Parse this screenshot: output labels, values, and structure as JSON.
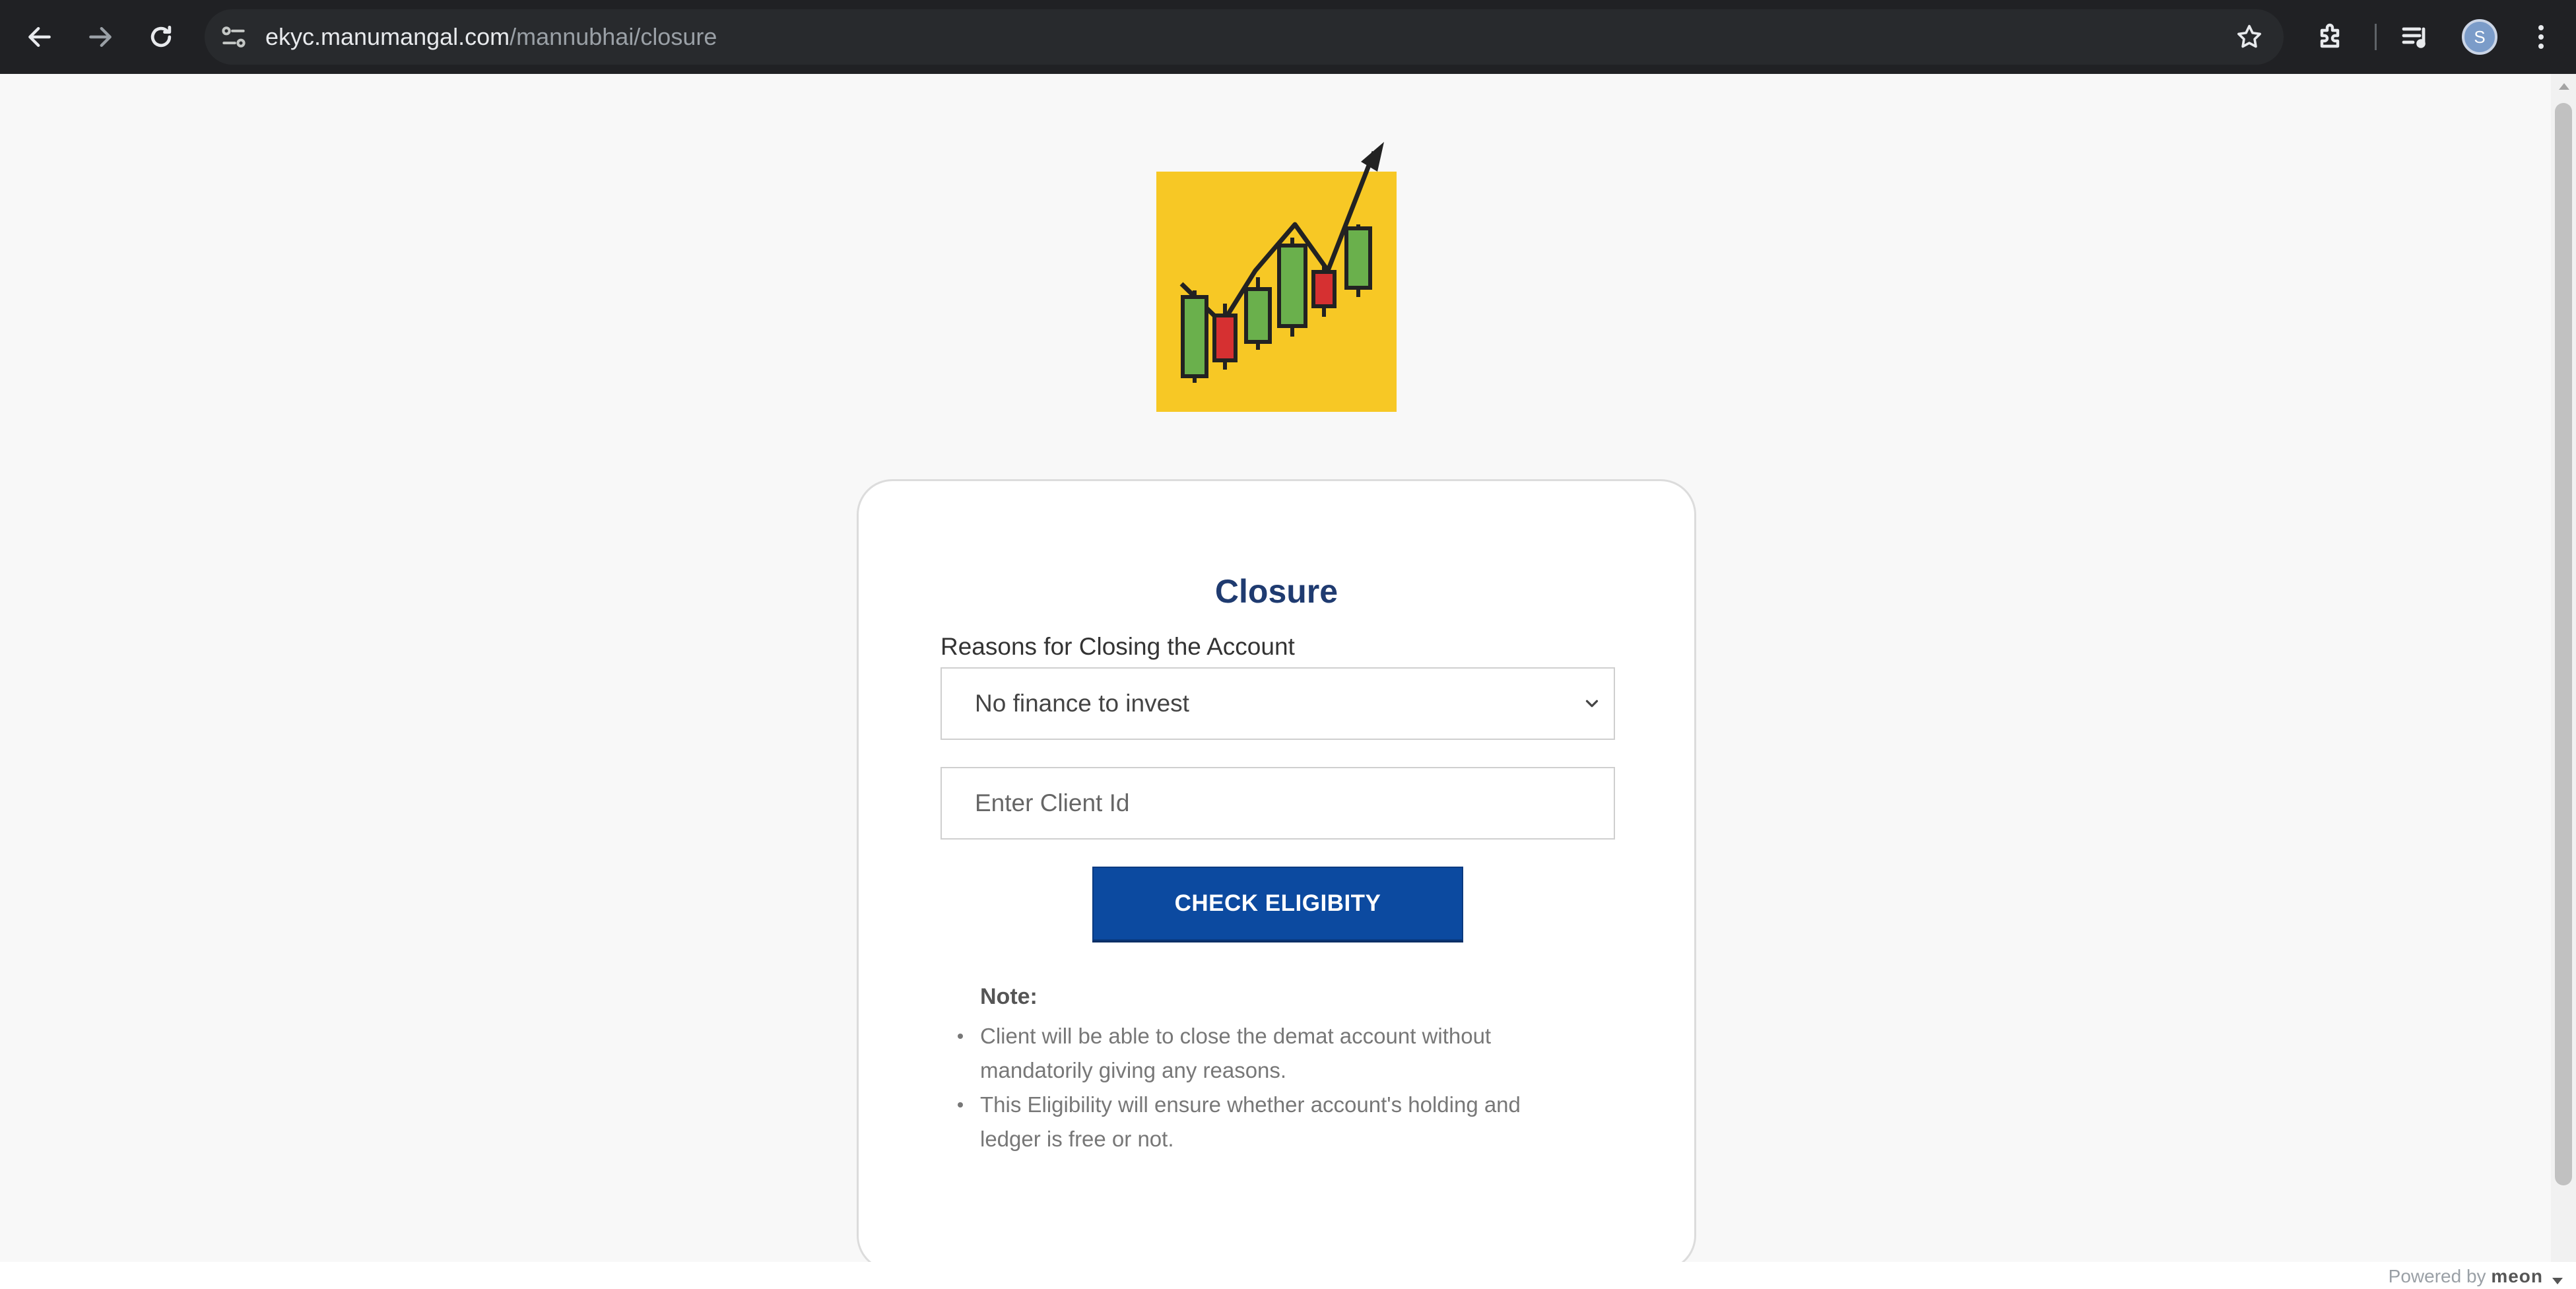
{
  "browser": {
    "url_host": "ekyc.manumangal.com",
    "url_path": "/mannubhai/closure",
    "profile_initial": "S"
  },
  "card": {
    "title": "Closure",
    "reason_label": "Reasons for Closing the Account",
    "reason_selected": "No finance to invest",
    "client_id_placeholder": "Enter Client Id",
    "check_button": "CHECK ELIGIBITY"
  },
  "note": {
    "title": "Note:",
    "items": [
      {
        "line1": "Client will be able to close the demat account without",
        "line2": "mandatorily giving any reasons."
      },
      {
        "line1": "This Eligibility will ensure whether account's holding and",
        "line2": "ledger is free or not."
      }
    ]
  },
  "footer": {
    "powered_prefix": "Powered by",
    "powered_brand": "meon"
  },
  "icons": {
    "back": "arrow-left-icon",
    "forward": "arrow-right-icon",
    "reload": "reload-icon",
    "site_info": "tune-icon",
    "bookmark": "star-icon",
    "extensions": "puzzle-icon",
    "media": "queue-music-icon",
    "menu": "more-vert-icon",
    "dropdown": "chevron-down-icon",
    "logo": "candlestick-chart-logo"
  },
  "colors": {
    "toolbar_bg": "#202124",
    "logo_bg": "#f7c825",
    "title": "#1f3b70",
    "button_bg": "#0c4aa0",
    "candle_green": "#6ab04c",
    "candle_red": "#d63031"
  }
}
